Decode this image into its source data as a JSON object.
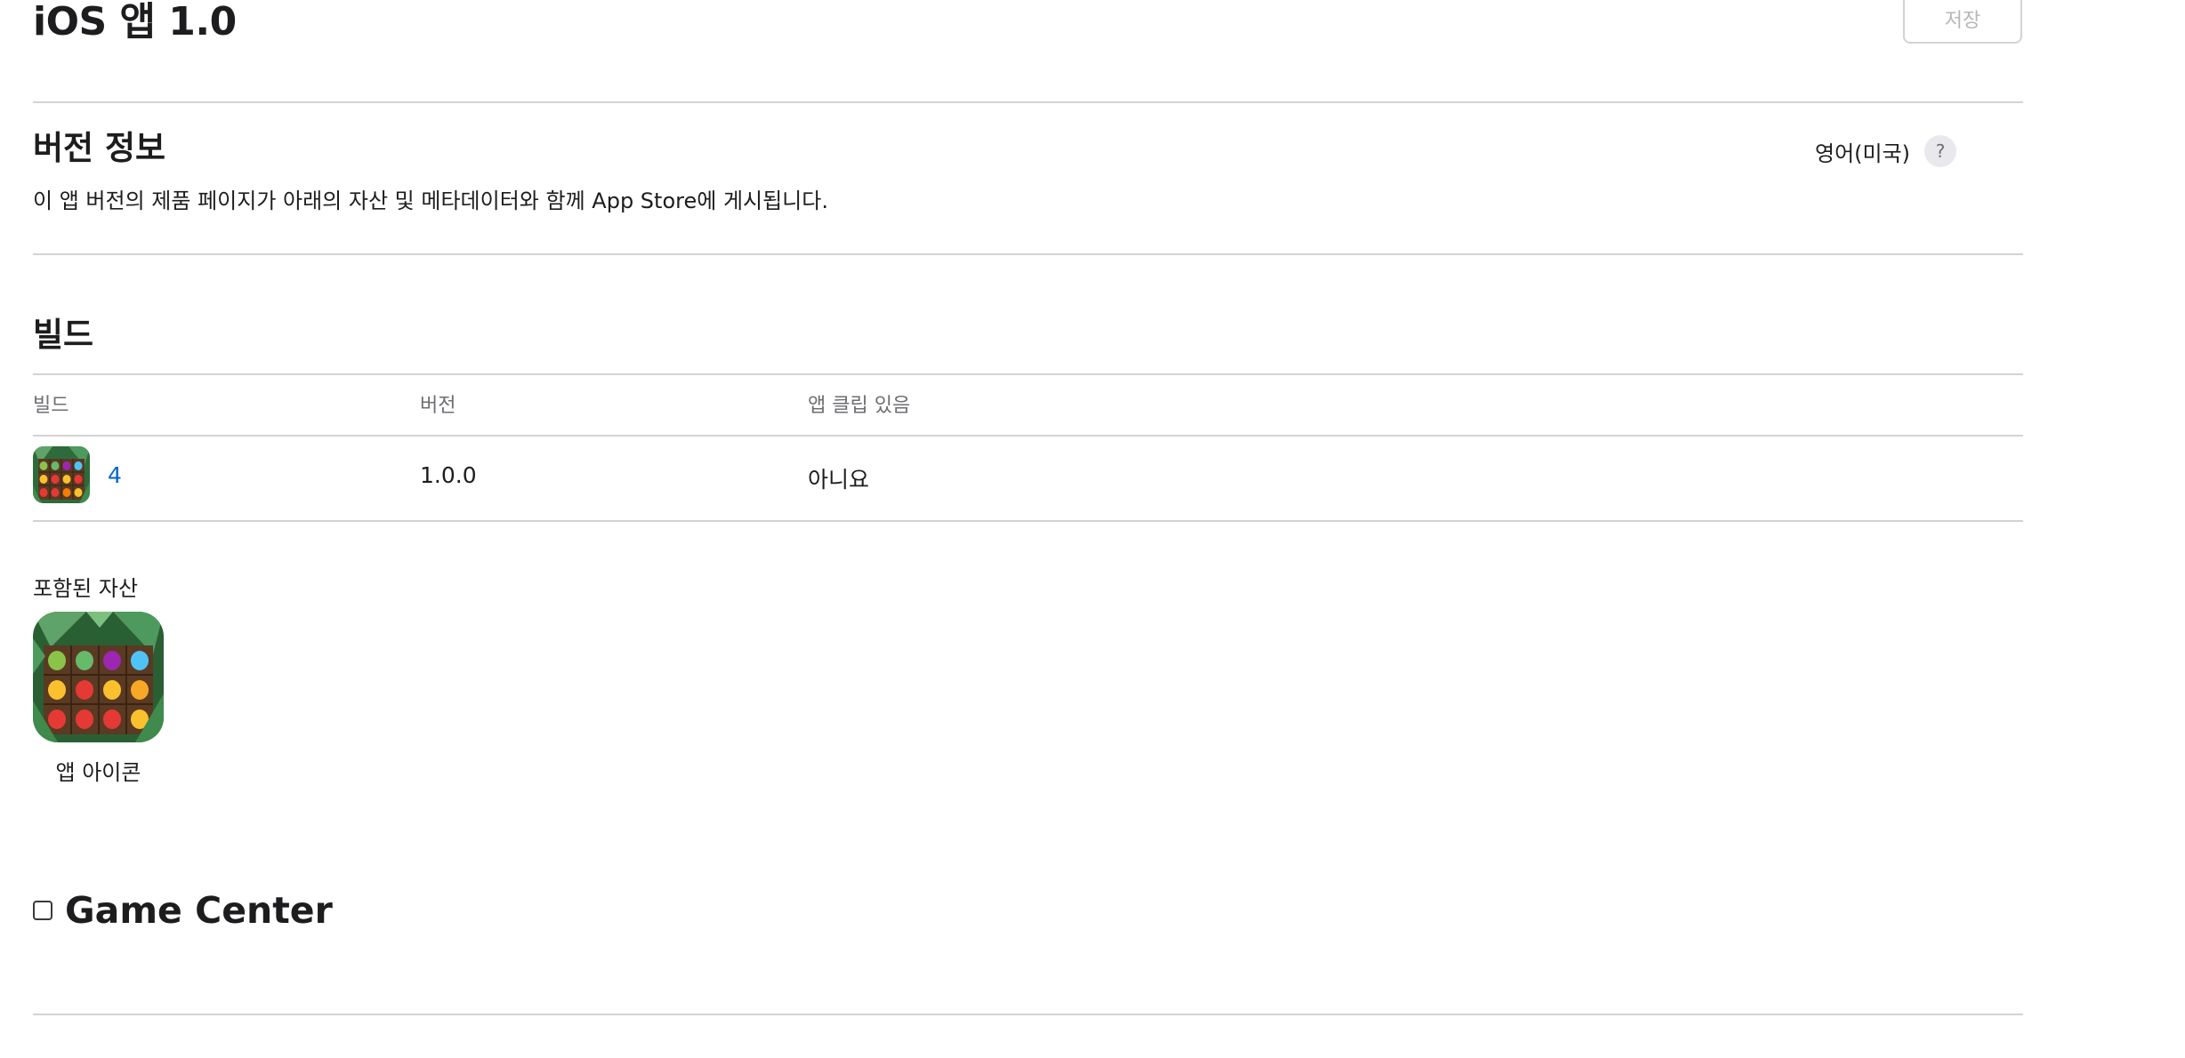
{
  "header": {
    "title": "iOS 앱 1.0",
    "save_label": "저장"
  },
  "version_info": {
    "heading": "버전 정보",
    "description": "이 앱 버전의 제품 페이지가 아래의 자산 및 메타데이터와 함께 App Store에 게시됩니다.",
    "language": "영어(미국)",
    "help_glyph": "?"
  },
  "build": {
    "heading": "빌드",
    "columns": [
      "빌드",
      "버전",
      "앱 클립 있음"
    ],
    "rows": [
      {
        "build": "4",
        "version": "1.0.0",
        "has_app_clip": "아니요"
      }
    ],
    "included_assets_label": "포함된 자산",
    "app_icon_label": "앱 아이콘"
  },
  "game_center": {
    "label": "Game Center",
    "checked": false
  },
  "colors": {
    "link": "#0066cc",
    "divider": "#d2d2d7",
    "text": "#1d1d1f",
    "muted": "#6e6e73"
  }
}
